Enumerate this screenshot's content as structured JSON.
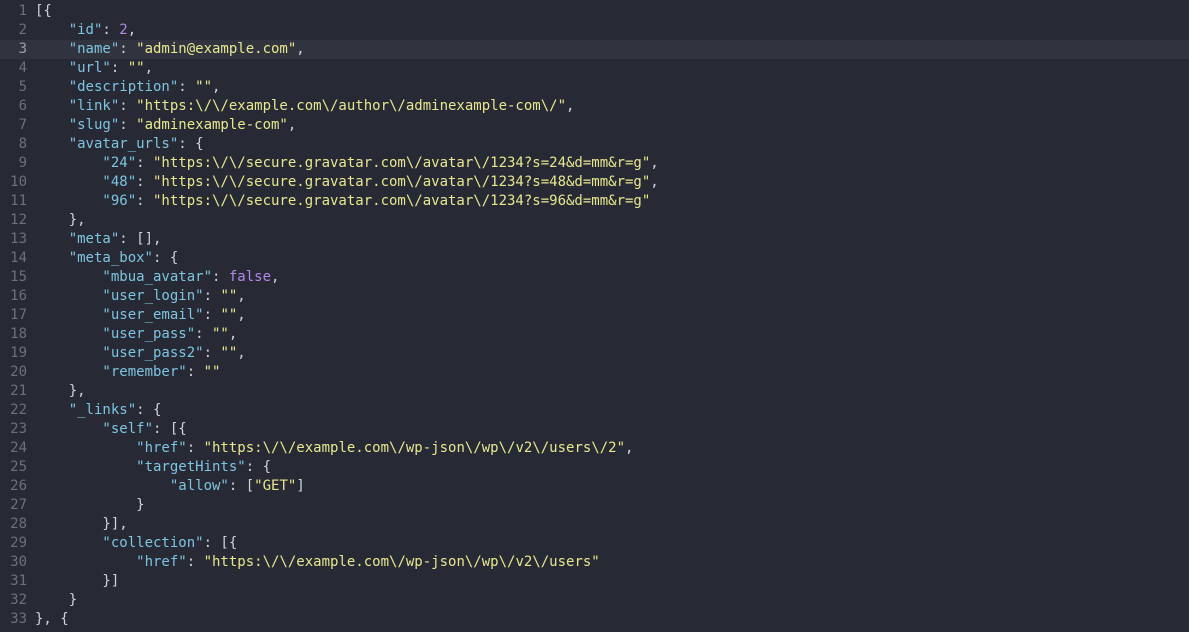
{
  "editor": {
    "active_line": 3,
    "colors": {
      "background": "#272a35",
      "active_line": "#31343f",
      "gutter_text": "#6b707c",
      "key": "#7ec4e0",
      "string": "#e8e78f",
      "literal": "#b18ae6",
      "punctuation": "#cfd3dc"
    },
    "lines": [
      {
        "num": "1",
        "indent": 0,
        "tokens": [
          [
            "p",
            "[{"
          ]
        ]
      },
      {
        "num": "2",
        "indent": 4,
        "tokens": [
          [
            "k",
            "\"id\""
          ],
          [
            "p",
            ": "
          ],
          [
            "n",
            "2"
          ],
          [
            "p",
            ","
          ]
        ]
      },
      {
        "num": "3",
        "indent": 4,
        "tokens": [
          [
            "k",
            "\"name\""
          ],
          [
            "p",
            ": "
          ],
          [
            "s",
            "\"admin@example.com\""
          ],
          [
            "p",
            ","
          ]
        ]
      },
      {
        "num": "4",
        "indent": 4,
        "tokens": [
          [
            "k",
            "\"url\""
          ],
          [
            "p",
            ": "
          ],
          [
            "s",
            "\"\""
          ],
          [
            "p",
            ","
          ]
        ]
      },
      {
        "num": "5",
        "indent": 4,
        "tokens": [
          [
            "k",
            "\"description\""
          ],
          [
            "p",
            ": "
          ],
          [
            "s",
            "\"\""
          ],
          [
            "p",
            ","
          ]
        ]
      },
      {
        "num": "6",
        "indent": 4,
        "tokens": [
          [
            "k",
            "\"link\""
          ],
          [
            "p",
            ": "
          ],
          [
            "s",
            "\"https:\\/\\/example.com\\/author\\/adminexample-com\\/\""
          ],
          [
            "p",
            ","
          ]
        ]
      },
      {
        "num": "7",
        "indent": 4,
        "tokens": [
          [
            "k",
            "\"slug\""
          ],
          [
            "p",
            ": "
          ],
          [
            "s",
            "\"adminexample-com\""
          ],
          [
            "p",
            ","
          ]
        ]
      },
      {
        "num": "8",
        "indent": 4,
        "tokens": [
          [
            "k",
            "\"avatar_urls\""
          ],
          [
            "p",
            ": {"
          ]
        ]
      },
      {
        "num": "9",
        "indent": 8,
        "tokens": [
          [
            "k",
            "\"24\""
          ],
          [
            "p",
            ": "
          ],
          [
            "s",
            "\"https:\\/\\/secure.gravatar.com\\/avatar\\/1234?s=24&d=mm&r=g\""
          ],
          [
            "p",
            ","
          ]
        ]
      },
      {
        "num": "10",
        "indent": 8,
        "tokens": [
          [
            "k",
            "\"48\""
          ],
          [
            "p",
            ": "
          ],
          [
            "s",
            "\"https:\\/\\/secure.gravatar.com\\/avatar\\/1234?s=48&d=mm&r=g\""
          ],
          [
            "p",
            ","
          ]
        ]
      },
      {
        "num": "11",
        "indent": 8,
        "tokens": [
          [
            "k",
            "\"96\""
          ],
          [
            "p",
            ": "
          ],
          [
            "s",
            "\"https:\\/\\/secure.gravatar.com\\/avatar\\/1234?s=96&d=mm&r=g\""
          ]
        ]
      },
      {
        "num": "12",
        "indent": 4,
        "tokens": [
          [
            "p",
            "},"
          ]
        ]
      },
      {
        "num": "13",
        "indent": 4,
        "tokens": [
          [
            "k",
            "\"meta\""
          ],
          [
            "p",
            ": [],"
          ]
        ]
      },
      {
        "num": "14",
        "indent": 4,
        "tokens": [
          [
            "k",
            "\"meta_box\""
          ],
          [
            "p",
            ": {"
          ]
        ]
      },
      {
        "num": "15",
        "indent": 8,
        "tokens": [
          [
            "k",
            "\"mbua_avatar\""
          ],
          [
            "p",
            ": "
          ],
          [
            "n",
            "false"
          ],
          [
            "p",
            ","
          ]
        ]
      },
      {
        "num": "16",
        "indent": 8,
        "tokens": [
          [
            "k",
            "\"user_login\""
          ],
          [
            "p",
            ": "
          ],
          [
            "s",
            "\"\""
          ],
          [
            "p",
            ","
          ]
        ]
      },
      {
        "num": "17",
        "indent": 8,
        "tokens": [
          [
            "k",
            "\"user_email\""
          ],
          [
            "p",
            ": "
          ],
          [
            "s",
            "\"\""
          ],
          [
            "p",
            ","
          ]
        ]
      },
      {
        "num": "18",
        "indent": 8,
        "tokens": [
          [
            "k",
            "\"user_pass\""
          ],
          [
            "p",
            ": "
          ],
          [
            "s",
            "\"\""
          ],
          [
            "p",
            ","
          ]
        ]
      },
      {
        "num": "19",
        "indent": 8,
        "tokens": [
          [
            "k",
            "\"user_pass2\""
          ],
          [
            "p",
            ": "
          ],
          [
            "s",
            "\"\""
          ],
          [
            "p",
            ","
          ]
        ]
      },
      {
        "num": "20",
        "indent": 8,
        "tokens": [
          [
            "k",
            "\"remember\""
          ],
          [
            "p",
            ": "
          ],
          [
            "s",
            "\"\""
          ]
        ]
      },
      {
        "num": "21",
        "indent": 4,
        "tokens": [
          [
            "p",
            "},"
          ]
        ]
      },
      {
        "num": "22",
        "indent": 4,
        "tokens": [
          [
            "k",
            "\"_links\""
          ],
          [
            "p",
            ": {"
          ]
        ]
      },
      {
        "num": "23",
        "indent": 8,
        "tokens": [
          [
            "k",
            "\"self\""
          ],
          [
            "p",
            ": [{"
          ]
        ]
      },
      {
        "num": "24",
        "indent": 12,
        "tokens": [
          [
            "k",
            "\"href\""
          ],
          [
            "p",
            ": "
          ],
          [
            "s",
            "\"https:\\/\\/example.com\\/wp-json\\/wp\\/v2\\/users\\/2\""
          ],
          [
            "p",
            ","
          ]
        ]
      },
      {
        "num": "25",
        "indent": 12,
        "tokens": [
          [
            "k",
            "\"targetHints\""
          ],
          [
            "p",
            ": {"
          ]
        ]
      },
      {
        "num": "26",
        "indent": 16,
        "tokens": [
          [
            "k",
            "\"allow\""
          ],
          [
            "p",
            ": ["
          ],
          [
            "s",
            "\"GET\""
          ],
          [
            "p",
            "]"
          ]
        ]
      },
      {
        "num": "27",
        "indent": 12,
        "tokens": [
          [
            "p",
            "}"
          ]
        ]
      },
      {
        "num": "28",
        "indent": 8,
        "tokens": [
          [
            "p",
            "}],"
          ]
        ]
      },
      {
        "num": "29",
        "indent": 8,
        "tokens": [
          [
            "k",
            "\"collection\""
          ],
          [
            "p",
            ": [{"
          ]
        ]
      },
      {
        "num": "30",
        "indent": 12,
        "tokens": [
          [
            "k",
            "\"href\""
          ],
          [
            "p",
            ": "
          ],
          [
            "s",
            "\"https:\\/\\/example.com\\/wp-json\\/wp\\/v2\\/users\""
          ]
        ]
      },
      {
        "num": "31",
        "indent": 8,
        "tokens": [
          [
            "p",
            "}]"
          ]
        ]
      },
      {
        "num": "32",
        "indent": 4,
        "tokens": [
          [
            "p",
            "}"
          ]
        ]
      },
      {
        "num": "33",
        "indent": 0,
        "tokens": [
          [
            "p",
            "}, {"
          ]
        ]
      }
    ]
  }
}
